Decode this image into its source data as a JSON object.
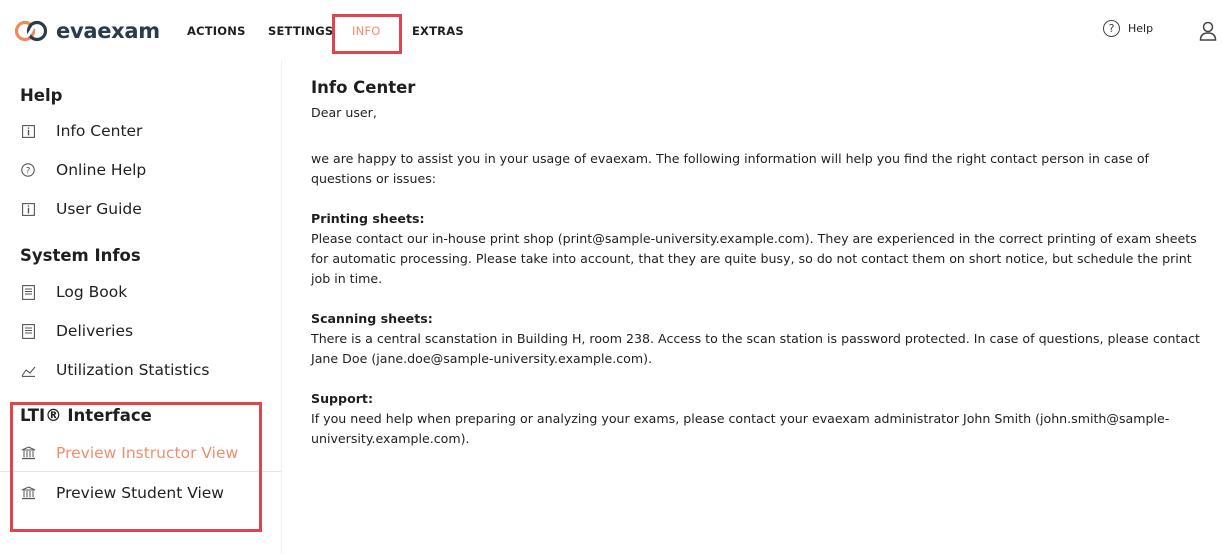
{
  "app": {
    "name": "evaexam",
    "brand_color": "#2b3b4a",
    "accent_color": "#ef8e6e",
    "highlight_color": "#e0454f"
  },
  "nav": {
    "items": [
      {
        "label": "ACTIONS"
      },
      {
        "label": "SETTINGS"
      },
      {
        "label": "INFO",
        "active": true
      },
      {
        "label": "EXTRAS"
      }
    ],
    "help_label": "Help",
    "help_icon": "question-circle-icon",
    "user_icon": "user-icon"
  },
  "sidebar": {
    "sections": [
      {
        "title": "Help",
        "items": [
          {
            "label": "Info Center",
            "icon": "info-box-icon"
          },
          {
            "label": "Online Help",
            "icon": "question-circle-icon"
          },
          {
            "label": "User Guide",
            "icon": "info-box-icon"
          }
        ]
      },
      {
        "title": "System Infos",
        "items": [
          {
            "label": "Log Book",
            "icon": "document-icon"
          },
          {
            "label": "Deliveries",
            "icon": "document-icon"
          },
          {
            "label": "Utilization Statistics",
            "icon": "chart-area-icon"
          }
        ]
      },
      {
        "title": "LTI® Interface",
        "items": [
          {
            "label": "Preview Instructor View",
            "icon": "institution-icon",
            "active": true
          },
          {
            "label": "Preview Student View",
            "icon": "institution-icon"
          }
        ]
      }
    ]
  },
  "content": {
    "title": "Info Center",
    "greeting": "Dear user,",
    "intro": "we are happy to assist you in your usage of evaexam. The following information will help you find the right contact person in case of questions or issues:",
    "printing_head": "Printing sheets:",
    "printing_text": "Please contact our in-house print shop (print@sample-university.example.com). They are experienced in the correct printing of exam sheets for automatic processing. Please take into account, that they are quite busy, so do not contact them on short notice, but schedule the print job in time.",
    "scanning_head": "Scanning sheets:",
    "scanning_text": "There is a central scanstation in Building H, room 238. Access to the scan station is password protected. In case of questions, please contact Jane Doe (jane.doe@sample-university.example.com).",
    "support_head": "Support:",
    "support_text": "If you need help when preparing or analyzing your exams, please contact your evaexam administrator John Smith (john.smith@sample-university.example.com)."
  }
}
